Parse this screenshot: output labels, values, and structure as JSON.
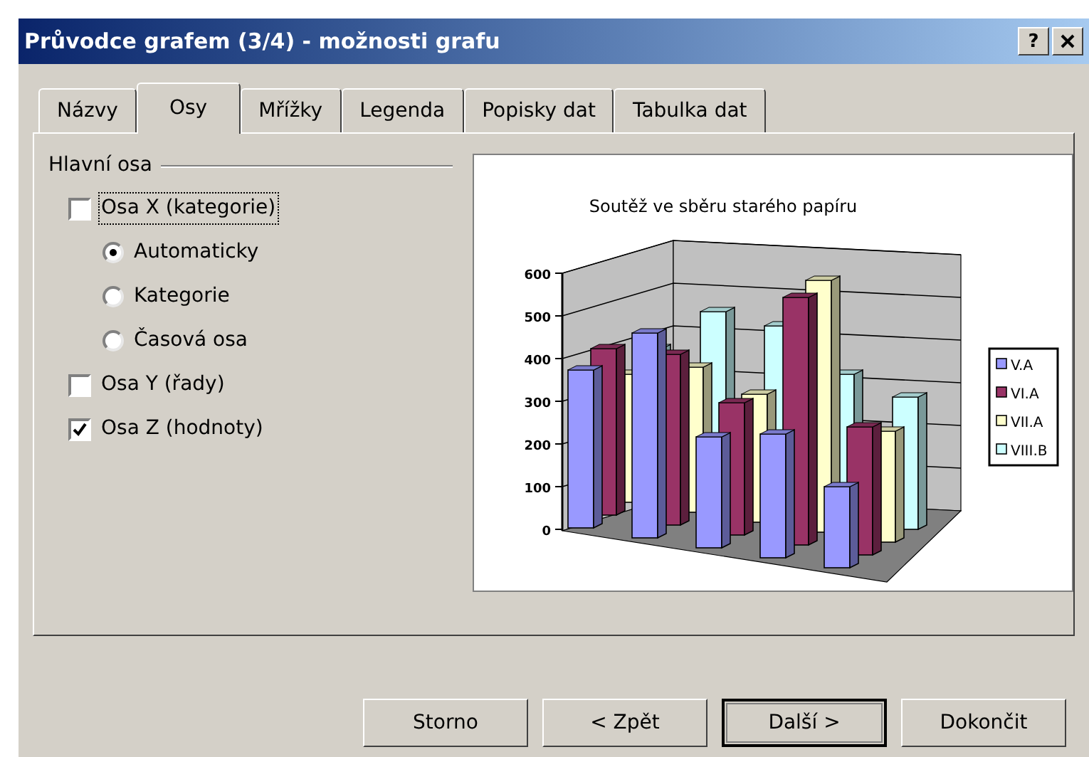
{
  "window": {
    "title": "Průvodce grafem (3/4) - možnosti grafu",
    "help": "?"
  },
  "tabs": [
    {
      "label": "Názvy",
      "selected": false
    },
    {
      "label": "Osy",
      "selected": true
    },
    {
      "label": "Mřížky",
      "selected": false
    },
    {
      "label": "Legenda",
      "selected": false
    },
    {
      "label": "Popisky dat",
      "selected": false
    },
    {
      "label": "Tabulka dat",
      "selected": false
    }
  ],
  "group": {
    "title": "Hlavní osa",
    "items": [
      {
        "kind": "checkbox",
        "label": "Osa X (kategorie)",
        "checked": false,
        "focused": true,
        "children": [
          {
            "kind": "radio",
            "label": "Automaticky",
            "selected": true
          },
          {
            "kind": "radio",
            "label": "Kategorie",
            "selected": false
          },
          {
            "kind": "radio",
            "label": "Časová osa",
            "selected": false
          }
        ]
      },
      {
        "kind": "checkbox",
        "label": "Osa Y (řady)",
        "checked": false,
        "focused": false
      },
      {
        "kind": "checkbox",
        "label": "Osa Z (hodnoty)",
        "checked": true,
        "focused": false
      }
    ]
  },
  "preview": {
    "title": "Soutěž ve sběru starého papíru",
    "axis_labels": [
      "600",
      "500",
      "400",
      "300",
      "200",
      "100",
      "0"
    ],
    "legend": [
      {
        "label": "V.A",
        "color": "#9999ff"
      },
      {
        "label": "VI.A",
        "color": "#993366"
      },
      {
        "label": "VII.A",
        "color": "#ffffcc"
      },
      {
        "label": "VIII.B",
        "color": "#ccffff"
      }
    ]
  },
  "buttons": [
    {
      "label": "Storno",
      "default": false
    },
    {
      "label": "< Zpět",
      "default": false
    },
    {
      "label": "Další >",
      "default": true
    },
    {
      "label": "Dokončit",
      "default": false
    }
  ]
}
